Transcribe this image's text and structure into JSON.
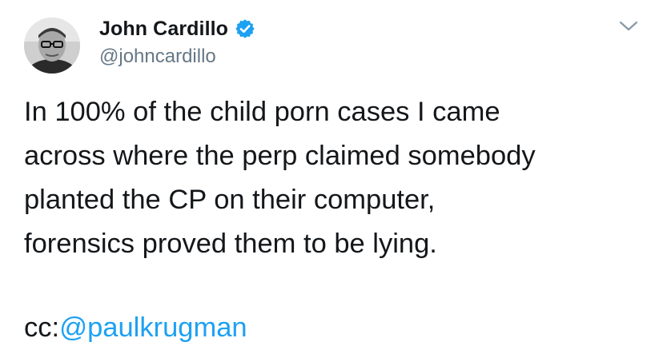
{
  "author": {
    "display_name": "John Cardillo",
    "handle": "@johncardillo",
    "verified": true,
    "avatar": "avatar-photo"
  },
  "icons": {
    "verified": "verified-badge-icon",
    "menu": "chevron-down-icon"
  },
  "tweet": {
    "text": "In 100% of the child porn cases I came\nacross where the perp claimed somebody\nplanted the CP on their computer,\nforensics proved them to be lying.",
    "cc_prefix": "cc:",
    "mention": "@paulkrugman"
  },
  "colors": {
    "text": "#14171a",
    "secondary": "#657786",
    "link": "#1da1f2",
    "verified": "#1da1f2"
  }
}
